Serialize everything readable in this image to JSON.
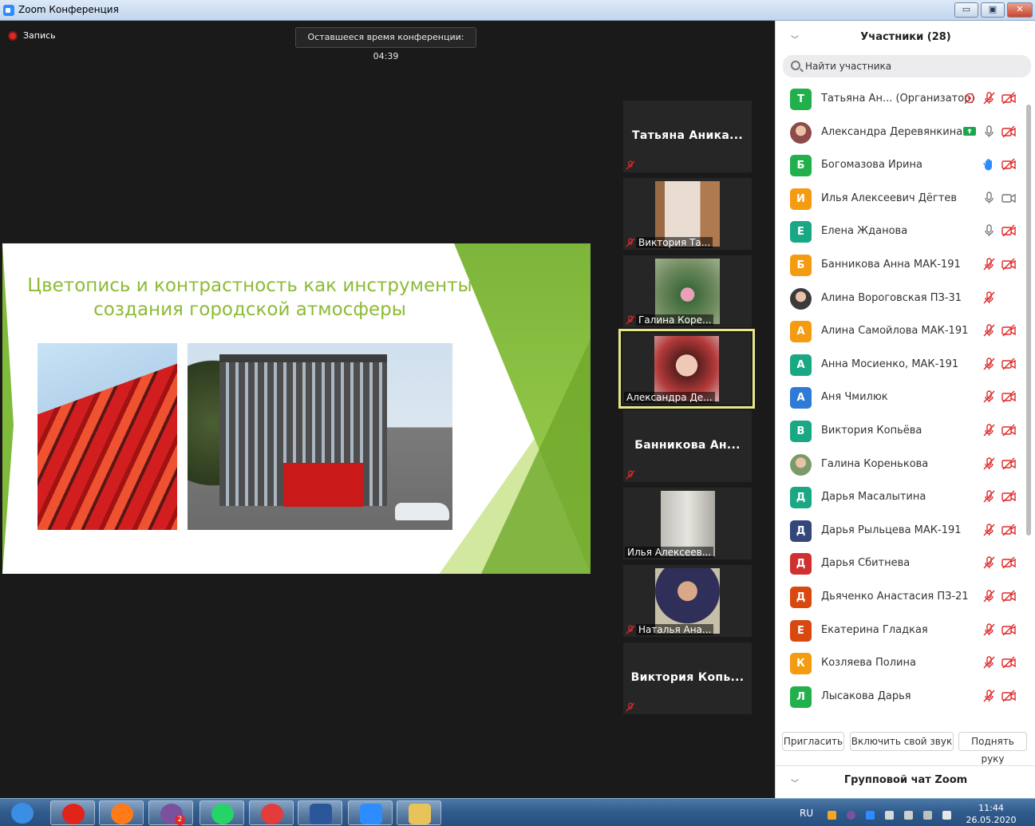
{
  "window": {
    "title": "Zoom Конференция",
    "min_label": "▭",
    "max_label": "▣",
    "close_label": "✕"
  },
  "meeting": {
    "recording_label": "Запись",
    "timer_text": "Оставшееся время конференции: 04:39"
  },
  "slide": {
    "title_line1": "Цветопись и контрастность как инструменты",
    "title_line2": "создания городской атмосферы"
  },
  "video_tiles": [
    {
      "name": "Татьяна  Аника...",
      "muted": true,
      "has_video": false
    },
    {
      "name": "Виктория Та...",
      "muted": true,
      "has_video": true
    },
    {
      "name": "Галина Коре...",
      "muted": true,
      "has_video": true
    },
    {
      "name": "Александра Де...",
      "muted": false,
      "has_video": true,
      "active": true
    },
    {
      "name": "Банникова  Ан...",
      "muted": true,
      "has_video": false
    },
    {
      "name": "Илья Алексеев...",
      "muted": false,
      "has_video": true
    },
    {
      "name": "Наталья Ана...",
      "muted": true,
      "has_video": true
    },
    {
      "name": "Виктория  Копь...",
      "muted": true,
      "has_video": false
    }
  ],
  "participants_panel": {
    "title": "Участники (28)",
    "search_placeholder": "Найти участника",
    "participants": [
      {
        "initial": "Т",
        "color": "#21b04b",
        "name": "Татьяна Ан...  (Организатор)",
        "mic": "muted",
        "video": "off",
        "host": true
      },
      {
        "initial": "",
        "color": "#8c4a4a",
        "name": "Александра Деревянкина",
        "mic": "on",
        "video": "off",
        "share": true
      },
      {
        "initial": "Б",
        "color": "#21b04b",
        "name": "Богомазова Ирина",
        "mic": "hand",
        "video": "off"
      },
      {
        "initial": "И",
        "color": "#f59b12",
        "name": "Илья Алексеевич Дёгтев",
        "mic": "on",
        "video": "on"
      },
      {
        "initial": "Е",
        "color": "#1aa884",
        "name": "Елена Жданова",
        "mic": "on",
        "video": "off"
      },
      {
        "initial": "Б",
        "color": "#f59b12",
        "name": " Банникова Анна МАК-191",
        "mic": "muted",
        "video": "off"
      },
      {
        "initial": "",
        "color": "#3b3b3b",
        "name": "Алина Вороговская ПЗ-31",
        "mic": "muted",
        "video": "none"
      },
      {
        "initial": "А",
        "color": "#f59b12",
        "name": "Алина Самойлова МАК-191",
        "mic": "muted",
        "video": "off"
      },
      {
        "initial": "А",
        "color": "#1aa884",
        "name": "Анна Мосиенко, МАК-191",
        "mic": "muted",
        "video": "off"
      },
      {
        "initial": "А",
        "color": "#2e7bd6",
        "name": "Аня Чмилюк",
        "mic": "muted",
        "video": "off"
      },
      {
        "initial": "В",
        "color": "#1aa884",
        "name": "Виктория Копьёва",
        "mic": "muted",
        "video": "off"
      },
      {
        "initial": "",
        "color": "#7a9a6a",
        "name": "Галина Коренькова",
        "mic": "muted",
        "video": "off"
      },
      {
        "initial": "Д",
        "color": "#1aa884",
        "name": "Дарья Масалытина",
        "mic": "muted",
        "video": "off"
      },
      {
        "initial": "Д",
        "color": "#33477a",
        "name": "Дарья Рыльцева МАК-191",
        "mic": "muted",
        "video": "off"
      },
      {
        "initial": "Д",
        "color": "#cf3131",
        "name": "Дарья Сбитнева",
        "mic": "muted",
        "video": "off"
      },
      {
        "initial": "Д",
        "color": "#d9480f",
        "name": "Дьяченко Анастасия ПЗ-21",
        "mic": "muted",
        "video": "off"
      },
      {
        "initial": "Е",
        "color": "#d9480f",
        "name": "Екатерина Гладкая",
        "mic": "muted",
        "video": "off"
      },
      {
        "initial": "К",
        "color": "#f59b12",
        "name": "Козляева Полина",
        "mic": "muted",
        "video": "off"
      },
      {
        "initial": "Л",
        "color": "#21b04b",
        "name": "Лысакова Дарья",
        "mic": "muted",
        "video": "off"
      }
    ],
    "buttons": {
      "invite": "Пригласить",
      "unmute": "Включить свой звук",
      "raise_hand": "Поднять руку"
    },
    "chat_title": "Групповой чат Zoom"
  },
  "taskbar": {
    "apps": [
      {
        "name": "start",
        "color": "#3a8ee6"
      },
      {
        "name": "yandex",
        "color": "#e2231a"
      },
      {
        "name": "firefox",
        "color": "#ff7a18"
      },
      {
        "name": "viber",
        "color": "#7b519d",
        "badge": "2"
      },
      {
        "name": "whatsapp",
        "color": "#25d366"
      },
      {
        "name": "clock-app",
        "color": "#e23c3c"
      },
      {
        "name": "word",
        "color": "#2b579a"
      },
      {
        "name": "zoom",
        "color": "#2d8cff"
      },
      {
        "name": "explorer",
        "color": "#e8c35a"
      }
    ],
    "lang": "RU",
    "time": "11:44",
    "date": "26.05.2020"
  }
}
